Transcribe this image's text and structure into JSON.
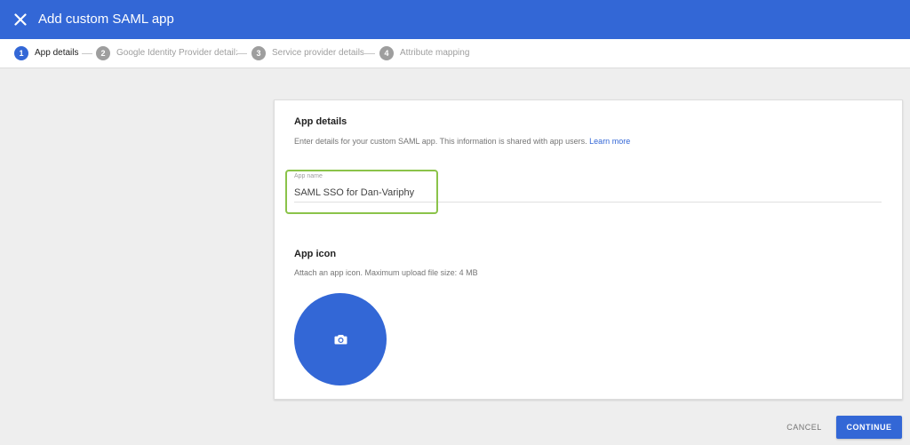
{
  "header": {
    "title": "Add custom SAML app",
    "close_icon": "close-icon",
    "background": "#3367d6"
  },
  "stepper": {
    "steps": [
      {
        "number": "1",
        "label": "App details",
        "active": true
      },
      {
        "number": "2",
        "label": "Google Identity Provider detail:",
        "active": false
      },
      {
        "number": "3",
        "label": "Service provider details",
        "active": false
      },
      {
        "number": "4",
        "label": "Attribute mapping",
        "active": false
      }
    ]
  },
  "app_details": {
    "title": "App details",
    "description": "Enter details for your custom SAML app. This information is shared with app users.",
    "learn_more": "Learn more",
    "app_name_label": "App name",
    "app_name_value": "SAML SSO for Dan-Variphy",
    "highlight_color": "#8bc34a"
  },
  "app_icon": {
    "title": "App icon",
    "description": "Attach an app icon. Maximum upload file size: 4 MB",
    "icon": "camera-icon",
    "color": "#3367d6"
  },
  "footer": {
    "cancel_label": "CANCEL",
    "continue_label": "CONTINUE"
  }
}
